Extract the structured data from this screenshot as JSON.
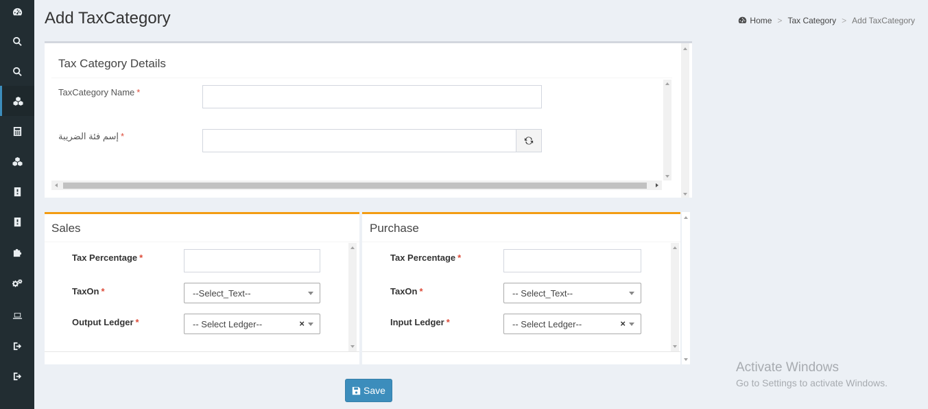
{
  "page": {
    "title": "Add TaxCategory",
    "breadcrumb": {
      "home": "Home",
      "section": "Tax Category",
      "current": "Add TaxCategory",
      "separator": ">"
    }
  },
  "sidebar": {
    "items": [
      {
        "icon": "dashboard-icon"
      },
      {
        "icon": "search-icon"
      },
      {
        "icon": "search-icon"
      },
      {
        "icon": "cubes-icon",
        "active": true
      },
      {
        "icon": "calculator-icon"
      },
      {
        "icon": "cubes-icon"
      },
      {
        "icon": "book-icon"
      },
      {
        "icon": "book-icon"
      },
      {
        "icon": "puzzle-icon"
      },
      {
        "icon": "gears-icon"
      },
      {
        "icon": "laptop-icon"
      },
      {
        "icon": "sign-out-icon"
      },
      {
        "icon": "sign-out-icon"
      }
    ]
  },
  "details": {
    "title": "Tax Category Details",
    "name_label": "TaxCategory Name",
    "name_value": "",
    "arabic_label": "إسم فئة الضريبة",
    "arabic_value": "",
    "required_mark": "*"
  },
  "sales": {
    "title": "Sales",
    "tax_percentage_label": "Tax Percentage",
    "tax_percentage_value": "",
    "taxon_label": "TaxOn",
    "taxon_selected": "--Select_Text--",
    "ledger_label": "Output Ledger",
    "ledger_selected": "-- Select Ledger--",
    "clear_symbol": "×"
  },
  "purchase": {
    "title": "Purchase",
    "tax_percentage_label": "Tax Percentage",
    "tax_percentage_value": "",
    "taxon_label": "TaxOn",
    "taxon_selected": "-- Select_Text--",
    "ledger_label": "Input Ledger",
    "ledger_selected": "-- Select Ledger--",
    "clear_symbol": "×"
  },
  "actions": {
    "save_label": "Save"
  },
  "watermark": {
    "line1": "Activate Windows",
    "line2": "Go to Settings to activate Windows."
  },
  "colors": {
    "sidebar": "#222d32",
    "primary": "#3c8dbc",
    "warning": "#f39c12",
    "required": "#dd4b39",
    "background": "#ecf0f5"
  }
}
